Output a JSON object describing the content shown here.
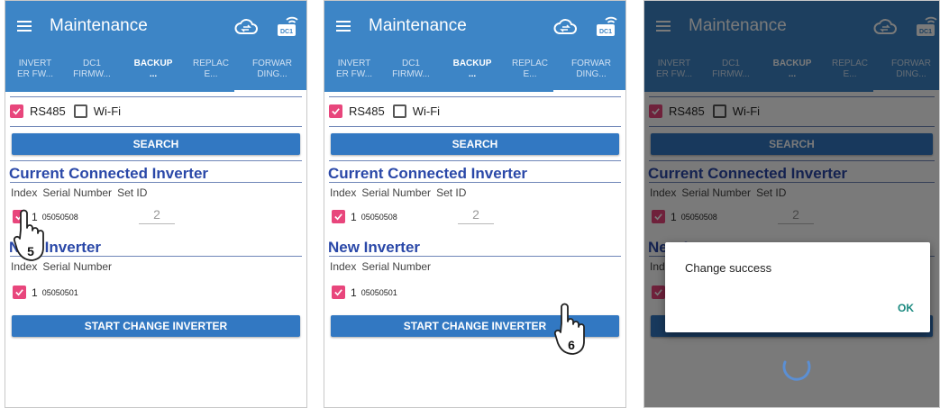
{
  "app": {
    "title": "Maintenance"
  },
  "tabs": [
    {
      "label": "INVERT\nER FW..."
    },
    {
      "label": "DC1\nFIRMW..."
    },
    {
      "label": "BACKUP\n..."
    },
    {
      "label": "REPLAC\nE..."
    },
    {
      "label": "FORWAR\nDING..."
    }
  ],
  "filters": {
    "rs485_label": "RS485",
    "wifi_label": "Wi-Fi",
    "rs485_checked": true,
    "wifi_checked": false
  },
  "search_button": "SEARCH",
  "current_section": {
    "title": "Current Connected Inverter",
    "columns": [
      "Index",
      "Serial Number",
      "Set ID"
    ],
    "row": {
      "index": "1",
      "serial": "05050508",
      "set_id": "2"
    }
  },
  "new_section": {
    "title": "New Inverter",
    "columns": [
      "Index",
      "Serial Number"
    ],
    "row": {
      "index": "1",
      "serial": "05050501"
    }
  },
  "start_button": "START CHANGE INVERTER",
  "steps": {
    "step5": "5",
    "step6": "6"
  },
  "dialog": {
    "message": "Change success",
    "ok_label": "OK"
  },
  "colors": {
    "accent": "#3d85c6",
    "button": "#3278c2",
    "checkbox": "#e8467c",
    "section_title": "#2a48a8",
    "ok_text": "#1b8a80"
  },
  "icons": [
    "menu-icon",
    "cloud-sync-icon",
    "dc1-wifi-icon",
    "checkmark-icon",
    "pointing-hand-icon",
    "loading-spinner-icon"
  ]
}
